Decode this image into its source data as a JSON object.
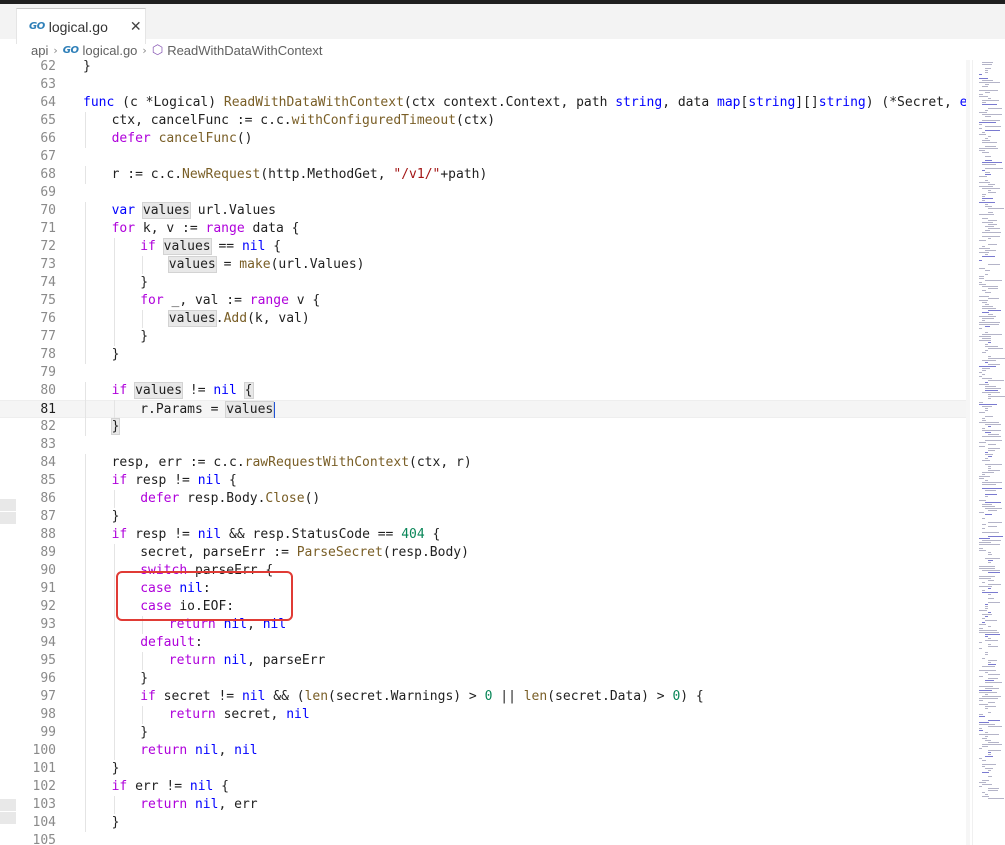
{
  "tab": {
    "icon": "go-file-icon",
    "filename": "logical.go",
    "close_glyph": "✕"
  },
  "breadcrumb": {
    "folder": "api",
    "file": "logical.go",
    "symbol": "ReadWithDataWithContext",
    "separator": "›"
  },
  "colors": {
    "keyword": "#af00db",
    "builtin": "#0000ff",
    "function": "#795e26",
    "type": "#267f99",
    "string": "#a31515",
    "number": "#098658",
    "highlight_box": "#e03b35"
  },
  "code": {
    "lines": [
      {
        "n": "62",
        "i": 0,
        "t": [
          [
            "p",
            "}"
          ]
        ]
      },
      {
        "n": "63",
        "i": 0,
        "t": []
      },
      {
        "n": "64",
        "i": 0,
        "t": [
          [
            "k2",
            "func"
          ],
          [
            "p",
            " (c *Logical) "
          ],
          [
            "f",
            "ReadWithDataWithContext"
          ],
          [
            "p",
            "(ctx context.Context, path "
          ],
          [
            "k2",
            "string"
          ],
          [
            "p",
            ", data "
          ],
          [
            "k2",
            "map"
          ],
          [
            "p",
            "["
          ],
          [
            "k2",
            "string"
          ],
          [
            "p",
            "][]"
          ],
          [
            "k2",
            "string"
          ],
          [
            "p",
            ") (*Secret, "
          ],
          [
            "k2",
            "error"
          ],
          [
            "p",
            ") {"
          ]
        ]
      },
      {
        "n": "65",
        "i": 1,
        "t": [
          [
            "p",
            "ctx, cancelFunc := c.c."
          ],
          [
            "f",
            "withConfiguredTimeout"
          ],
          [
            "p",
            "(ctx)"
          ]
        ]
      },
      {
        "n": "66",
        "i": 1,
        "t": [
          [
            "k",
            "defer"
          ],
          [
            "p",
            " "
          ],
          [
            "f",
            "cancelFunc"
          ],
          [
            "p",
            "()"
          ]
        ]
      },
      {
        "n": "67",
        "i": 0,
        "t": []
      },
      {
        "n": "68",
        "i": 1,
        "t": [
          [
            "p",
            "r := c.c."
          ],
          [
            "f",
            "NewRequest"
          ],
          [
            "p",
            "(http.MethodGet, "
          ],
          [
            "s",
            "\"/v1/\""
          ],
          [
            "p",
            "+path)"
          ]
        ]
      },
      {
        "n": "69",
        "i": 0,
        "t": []
      },
      {
        "n": "70",
        "i": 1,
        "t": [
          [
            "k2",
            "var"
          ],
          [
            "p",
            " "
          ],
          [
            "h",
            "values"
          ],
          [
            "p",
            " url.Values"
          ]
        ]
      },
      {
        "n": "71",
        "i": 1,
        "t": [
          [
            "k",
            "for"
          ],
          [
            "p",
            " k, v := "
          ],
          [
            "k",
            "range"
          ],
          [
            "p",
            " data {"
          ]
        ]
      },
      {
        "n": "72",
        "i": 2,
        "t": [
          [
            "k",
            "if"
          ],
          [
            "p",
            " "
          ],
          [
            "h",
            "values"
          ],
          [
            "p",
            " == "
          ],
          [
            "k2",
            "nil"
          ],
          [
            "p",
            " {"
          ]
        ]
      },
      {
        "n": "73",
        "i": 3,
        "t": [
          [
            "h",
            "values"
          ],
          [
            "p",
            " = "
          ],
          [
            "f",
            "make"
          ],
          [
            "p",
            "(url.Values)"
          ]
        ]
      },
      {
        "n": "74",
        "i": 2,
        "t": [
          [
            "p",
            "}"
          ]
        ]
      },
      {
        "n": "75",
        "i": 2,
        "t": [
          [
            "k",
            "for"
          ],
          [
            "p",
            " _, val := "
          ],
          [
            "k",
            "range"
          ],
          [
            "p",
            " v {"
          ]
        ]
      },
      {
        "n": "76",
        "i": 3,
        "t": [
          [
            "h",
            "values"
          ],
          [
            "p",
            "."
          ],
          [
            "f",
            "Add"
          ],
          [
            "p",
            "(k, val)"
          ]
        ]
      },
      {
        "n": "77",
        "i": 2,
        "t": [
          [
            "p",
            "}"
          ]
        ]
      },
      {
        "n": "78",
        "i": 1,
        "t": [
          [
            "p",
            "}"
          ]
        ]
      },
      {
        "n": "79",
        "i": 0,
        "t": []
      },
      {
        "n": "80",
        "i": 1,
        "t": [
          [
            "k",
            "if"
          ],
          [
            "p",
            " "
          ],
          [
            "h",
            "values"
          ],
          [
            "p",
            " != "
          ],
          [
            "k2",
            "nil"
          ],
          [
            "p",
            " "
          ],
          [
            "h",
            "{"
          ]
        ]
      },
      {
        "n": "81",
        "i": 2,
        "t": [
          [
            "p",
            "r.Params = "
          ],
          [
            "h",
            "values"
          ],
          [
            "c",
            ""
          ]
        ]
      },
      {
        "n": "82",
        "i": 1,
        "t": [
          [
            "h",
            "}"
          ]
        ]
      },
      {
        "n": "83",
        "i": 0,
        "t": []
      },
      {
        "n": "84",
        "i": 1,
        "t": [
          [
            "p",
            "resp, err := c.c."
          ],
          [
            "f",
            "rawRequestWithContext"
          ],
          [
            "p",
            "(ctx, r)"
          ]
        ]
      },
      {
        "n": "85",
        "i": 1,
        "t": [
          [
            "k",
            "if"
          ],
          [
            "p",
            " resp != "
          ],
          [
            "k2",
            "nil"
          ],
          [
            "p",
            " {"
          ]
        ]
      },
      {
        "n": "86",
        "i": 2,
        "t": [
          [
            "k",
            "defer"
          ],
          [
            "p",
            " resp.Body."
          ],
          [
            "f",
            "Close"
          ],
          [
            "p",
            "()"
          ]
        ]
      },
      {
        "n": "87",
        "i": 1,
        "t": [
          [
            "p",
            "}"
          ]
        ]
      },
      {
        "n": "88",
        "i": 1,
        "t": [
          [
            "k",
            "if"
          ],
          [
            "p",
            " resp != "
          ],
          [
            "k2",
            "nil"
          ],
          [
            "p",
            " && resp.StatusCode == "
          ],
          [
            "n",
            "404"
          ],
          [
            "p",
            " {"
          ]
        ]
      },
      {
        "n": "89",
        "i": 2,
        "t": [
          [
            "p",
            "secret, parseErr := "
          ],
          [
            "f",
            "ParseSecret"
          ],
          [
            "p",
            "(resp.Body)"
          ]
        ]
      },
      {
        "n": "90",
        "i": 2,
        "t": [
          [
            "k",
            "switch"
          ],
          [
            "p",
            " parseErr {"
          ]
        ]
      },
      {
        "n": "91",
        "i": 2,
        "t": [
          [
            "k",
            "case"
          ],
          [
            "p",
            " "
          ],
          [
            "k2",
            "nil"
          ],
          [
            "p",
            ":"
          ]
        ]
      },
      {
        "n": "92",
        "i": 2,
        "t": [
          [
            "k",
            "case"
          ],
          [
            "p",
            " io.EOF:"
          ]
        ]
      },
      {
        "n": "93",
        "i": 3,
        "t": [
          [
            "k",
            "return"
          ],
          [
            "p",
            " "
          ],
          [
            "k2",
            "nil"
          ],
          [
            "p",
            ", "
          ],
          [
            "k2",
            "nil"
          ]
        ]
      },
      {
        "n": "94",
        "i": 2,
        "t": [
          [
            "k",
            "default"
          ],
          [
            "p",
            ":"
          ]
        ]
      },
      {
        "n": "95",
        "i": 3,
        "t": [
          [
            "k",
            "return"
          ],
          [
            "p",
            " "
          ],
          [
            "k2",
            "nil"
          ],
          [
            "p",
            ", parseErr"
          ]
        ]
      },
      {
        "n": "96",
        "i": 2,
        "t": [
          [
            "p",
            "}"
          ]
        ]
      },
      {
        "n": "97",
        "i": 2,
        "t": [
          [
            "k",
            "if"
          ],
          [
            "p",
            " secret != "
          ],
          [
            "k2",
            "nil"
          ],
          [
            "p",
            " && ("
          ],
          [
            "f",
            "len"
          ],
          [
            "p",
            "(secret.Warnings) > "
          ],
          [
            "n",
            "0"
          ],
          [
            "p",
            " || "
          ],
          [
            "f",
            "len"
          ],
          [
            "p",
            "(secret.Data) > "
          ],
          [
            "n",
            "0"
          ],
          [
            "p",
            ") {"
          ]
        ]
      },
      {
        "n": "98",
        "i": 3,
        "t": [
          [
            "k",
            "return"
          ],
          [
            "p",
            " secret, "
          ],
          [
            "k2",
            "nil"
          ]
        ]
      },
      {
        "n": "99",
        "i": 2,
        "t": [
          [
            "p",
            "}"
          ]
        ]
      },
      {
        "n": "100",
        "i": 2,
        "t": [
          [
            "k",
            "return"
          ],
          [
            "p",
            " "
          ],
          [
            "k2",
            "nil"
          ],
          [
            "p",
            ", "
          ],
          [
            "k2",
            "nil"
          ]
        ]
      },
      {
        "n": "101",
        "i": 1,
        "t": [
          [
            "p",
            "}"
          ]
        ]
      },
      {
        "n": "102",
        "i": 1,
        "t": [
          [
            "k",
            "if"
          ],
          [
            "p",
            " err != "
          ],
          [
            "k2",
            "nil"
          ],
          [
            "p",
            " {"
          ]
        ]
      },
      {
        "n": "103",
        "i": 2,
        "t": [
          [
            "k",
            "return"
          ],
          [
            "p",
            " "
          ],
          [
            "k2",
            "nil"
          ],
          [
            "p",
            ", err"
          ]
        ]
      },
      {
        "n": "104",
        "i": 1,
        "t": [
          [
            "p",
            "}"
          ]
        ]
      },
      {
        "n": "105",
        "i": 0,
        "t": []
      }
    ],
    "current_line": "81"
  }
}
